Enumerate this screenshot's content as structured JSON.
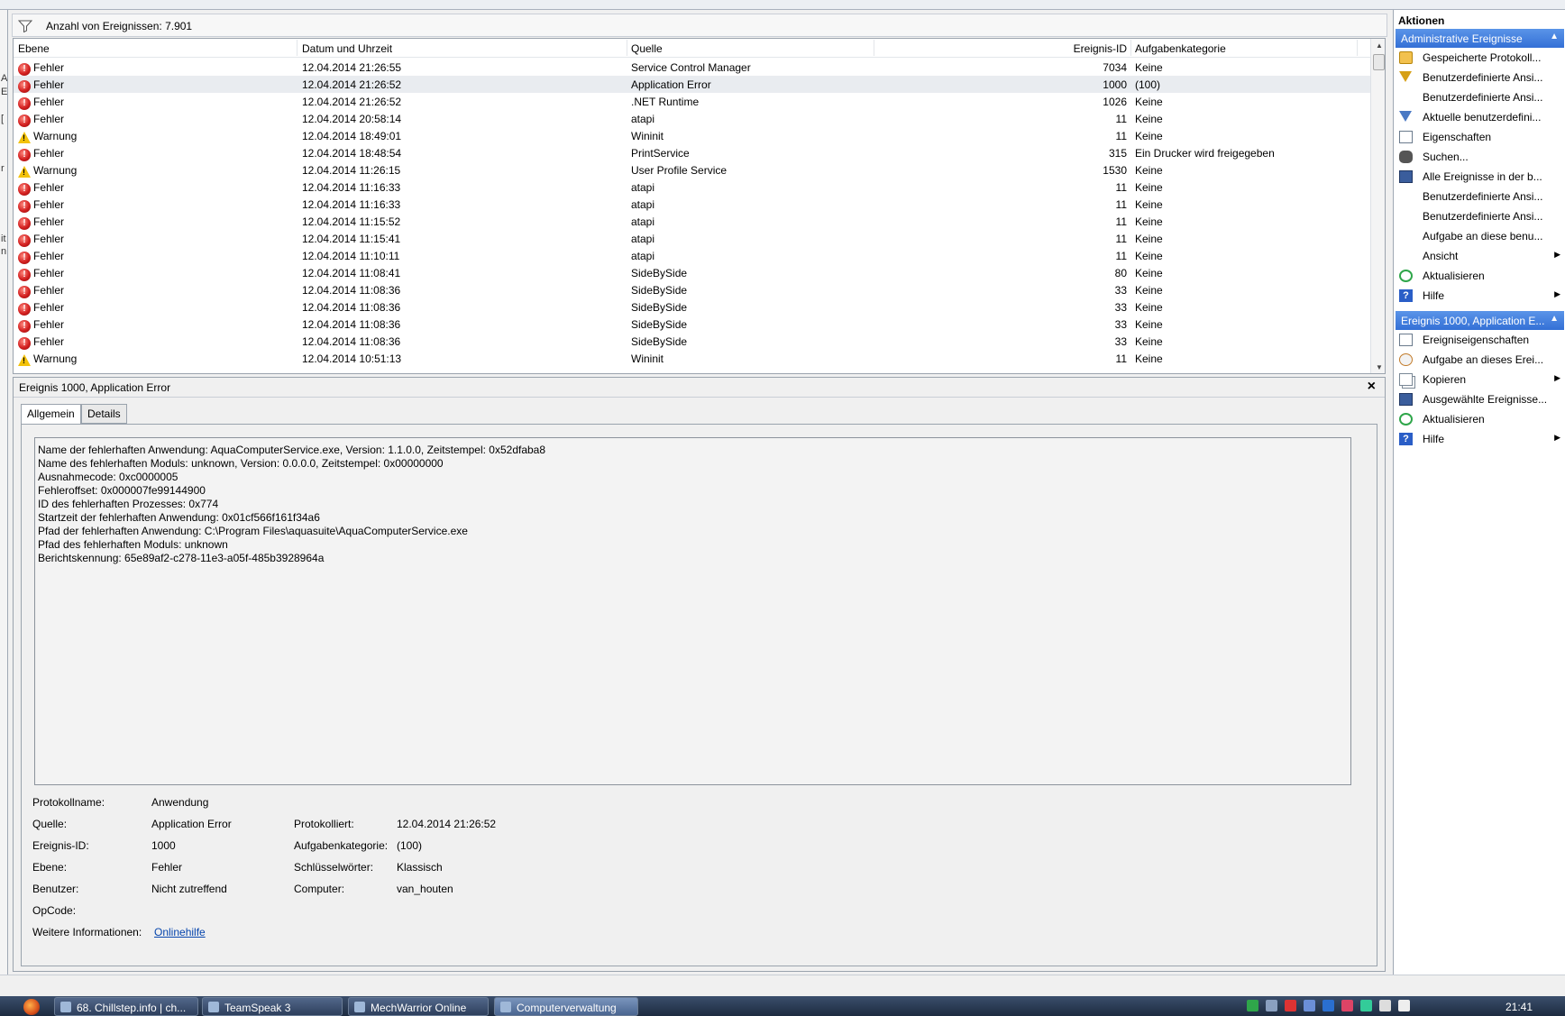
{
  "filter": {
    "count_label": "Anzahl von Ereignissen: 7.901"
  },
  "grid": {
    "columns": [
      "Ebene",
      "Datum und Uhrzeit",
      "Quelle",
      "Ereignis-ID",
      "Aufgabenkategorie"
    ],
    "rows": [
      {
        "level": "Fehler",
        "type": "error",
        "datetime": "12.04.2014 21:26:55",
        "source": "Service Control Manager",
        "id": "7034",
        "category": "Keine"
      },
      {
        "level": "Fehler",
        "type": "error",
        "datetime": "12.04.2014 21:26:52",
        "source": "Application Error",
        "id": "1000",
        "category": "(100)"
      },
      {
        "level": "Fehler",
        "type": "error",
        "datetime": "12.04.2014 21:26:52",
        "source": ".NET Runtime",
        "id": "1026",
        "category": "Keine"
      },
      {
        "level": "Fehler",
        "type": "error",
        "datetime": "12.04.2014 20:58:14",
        "source": "atapi",
        "id": "11",
        "category": "Keine"
      },
      {
        "level": "Warnung",
        "type": "warning",
        "datetime": "12.04.2014 18:49:01",
        "source": "Wininit",
        "id": "11",
        "category": "Keine"
      },
      {
        "level": "Fehler",
        "type": "error",
        "datetime": "12.04.2014 18:48:54",
        "source": "PrintService",
        "id": "315",
        "category": "Ein Drucker wird freigegeben"
      },
      {
        "level": "Warnung",
        "type": "warning",
        "datetime": "12.04.2014 11:26:15",
        "source": "User Profile Service",
        "id": "1530",
        "category": "Keine"
      },
      {
        "level": "Fehler",
        "type": "error",
        "datetime": "12.04.2014 11:16:33",
        "source": "atapi",
        "id": "11",
        "category": "Keine"
      },
      {
        "level": "Fehler",
        "type": "error",
        "datetime": "12.04.2014 11:16:33",
        "source": "atapi",
        "id": "11",
        "category": "Keine"
      },
      {
        "level": "Fehler",
        "type": "error",
        "datetime": "12.04.2014 11:15:52",
        "source": "atapi",
        "id": "11",
        "category": "Keine"
      },
      {
        "level": "Fehler",
        "type": "error",
        "datetime": "12.04.2014 11:15:41",
        "source": "atapi",
        "id": "11",
        "category": "Keine"
      },
      {
        "level": "Fehler",
        "type": "error",
        "datetime": "12.04.2014 11:10:11",
        "source": "atapi",
        "id": "11",
        "category": "Keine"
      },
      {
        "level": "Fehler",
        "type": "error",
        "datetime": "12.04.2014 11:08:41",
        "source": "SideBySide",
        "id": "80",
        "category": "Keine"
      },
      {
        "level": "Fehler",
        "type": "error",
        "datetime": "12.04.2014 11:08:36",
        "source": "SideBySide",
        "id": "33",
        "category": "Keine"
      },
      {
        "level": "Fehler",
        "type": "error",
        "datetime": "12.04.2014 11:08:36",
        "source": "SideBySide",
        "id": "33",
        "category": "Keine"
      },
      {
        "level": "Fehler",
        "type": "error",
        "datetime": "12.04.2014 11:08:36",
        "source": "SideBySide",
        "id": "33",
        "category": "Keine"
      },
      {
        "level": "Fehler",
        "type": "error",
        "datetime": "12.04.2014 11:08:36",
        "source": "SideBySide",
        "id": "33",
        "category": "Keine"
      },
      {
        "level": "Warnung",
        "type": "warning",
        "datetime": "12.04.2014 10:51:13",
        "source": "Wininit",
        "id": "11",
        "category": "Keine"
      }
    ],
    "selected_index": 1
  },
  "detail": {
    "title": "Ereignis 1000, Application Error",
    "tabs": [
      "Allgemein",
      "Details"
    ],
    "description_lines": [
      "Name der fehlerhaften Anwendung: AquaComputerService.exe, Version: 1.1.0.0, Zeitstempel: 0x52dfaba8",
      "Name des fehlerhaften Moduls: unknown, Version: 0.0.0.0, Zeitstempel: 0x00000000",
      "Ausnahmecode: 0xc0000005",
      "Fehleroffset: 0x000007fe99144900",
      "ID des fehlerhaften Prozesses: 0x774",
      "Startzeit der fehlerhaften Anwendung: 0x01cf566f161f34a6",
      "Pfad der fehlerhaften Anwendung: C:\\Program Files\\aquasuite\\AquaComputerService.exe",
      "Pfad des fehlerhaften Moduls: unknown",
      "Berichtskennung: 65e89af2-c278-11e3-a05f-485b3928964a"
    ],
    "props": {
      "protokollname_label": "Protokollname:",
      "protokollname": "Anwendung",
      "quelle_label": "Quelle:",
      "quelle": "Application Error",
      "protokolliert_label": "Protokolliert:",
      "protokolliert": "12.04.2014 21:26:52",
      "ereignisid_label": "Ereignis-ID:",
      "ereignisid": "1000",
      "aufgabenkategorie_label": "Aufgabenkategorie:",
      "aufgabenkategorie": "(100)",
      "ebene_label": "Ebene:",
      "ebene": "Fehler",
      "schluesselwoerter_label": "Schlüsselwörter:",
      "schluesselwoerter": "Klassisch",
      "benutzer_label": "Benutzer:",
      "benutzer": "Nicht zutreffend",
      "computer_label": "Computer:",
      "computer": "van_houten",
      "opcode_label": "OpCode:",
      "weitere_label": "Weitere Informationen:",
      "onlinehilfe": "Onlinehilfe"
    }
  },
  "actions": {
    "title": "Aktionen",
    "section1": "Administrative Ereignisse",
    "items1": [
      {
        "label": "Gespeicherte Protokoll...",
        "icon": "folder-icon"
      },
      {
        "label": "Benutzerdefinierte Ansi...",
        "icon": "filter-icon"
      },
      {
        "label": "Benutzerdefinierte Ansi...",
        "icon": ""
      },
      {
        "label": "Aktuelle benutzerdefini...",
        "icon": "filter-icon"
      },
      {
        "label": "Eigenschaften",
        "icon": "properties-icon"
      },
      {
        "label": "Suchen...",
        "icon": "binoculars-icon"
      },
      {
        "label": "Alle Ereignisse in der b...",
        "icon": "save-icon"
      },
      {
        "label": "Benutzerdefinierte Ansi...",
        "icon": ""
      },
      {
        "label": "Benutzerdefinierte Ansi...",
        "icon": ""
      },
      {
        "label": "Aufgabe an diese benu...",
        "icon": ""
      },
      {
        "label": "Ansicht",
        "icon": "",
        "submenu": true
      },
      {
        "label": "Aktualisieren",
        "icon": "refresh-icon"
      },
      {
        "label": "Hilfe",
        "icon": "help-icon",
        "submenu": true
      }
    ],
    "section2": "Ereignis 1000, Application E...",
    "items2": [
      {
        "label": "Ereigniseigenschaften",
        "icon": "properties-icon"
      },
      {
        "label": "Aufgabe an dieses Erei...",
        "icon": "task-icon"
      },
      {
        "label": "Kopieren",
        "icon": "copy-icon",
        "submenu": true
      },
      {
        "label": "Ausgewählte Ereignisse...",
        "icon": "save-icon"
      },
      {
        "label": "Aktualisieren",
        "icon": "refresh-icon"
      },
      {
        "label": "Hilfe",
        "icon": "help-icon",
        "submenu": true
      }
    ]
  },
  "taskbar": {
    "items": [
      "68. Chillstep.info | ch...",
      "TeamSpeak 3",
      "MechWarrior Online",
      "Computerverwaltung"
    ],
    "clock": "21:41"
  },
  "colors": {
    "accent": "#3470d6",
    "error": "#d32020",
    "warning": "#f3c20a",
    "link": "#0645ad"
  }
}
